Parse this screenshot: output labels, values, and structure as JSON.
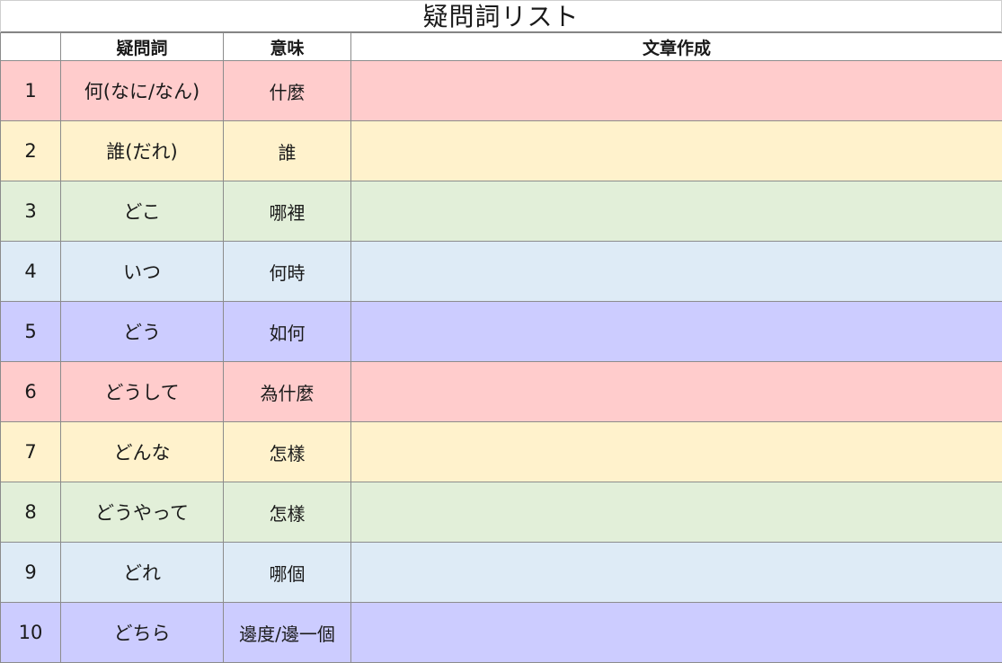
{
  "title": "疑問詞リスト",
  "headers": {
    "number": "",
    "word": "疑問詞",
    "meaning": "意味",
    "sentence": "文章作成"
  },
  "row_colors": {
    "red": "#ffcccc",
    "yellow": "#fff2cc",
    "green": "#e2efd9",
    "blue": "#deebf6",
    "purple": "#ccccff"
  },
  "rows": [
    {
      "num": "1",
      "word": "何(なに/なん)",
      "meaning": "什麼",
      "sentence": "",
      "color": "red"
    },
    {
      "num": "2",
      "word": "誰(だれ)",
      "meaning": "誰",
      "sentence": "",
      "color": "yellow"
    },
    {
      "num": "3",
      "word": "どこ",
      "meaning": "哪裡",
      "sentence": "",
      "color": "green"
    },
    {
      "num": "4",
      "word": "いつ",
      "meaning": "何時",
      "sentence": "",
      "color": "blue"
    },
    {
      "num": "5",
      "word": "どう",
      "meaning": "如何",
      "sentence": "",
      "color": "purple"
    },
    {
      "num": "6",
      "word": "どうして",
      "meaning": "為什麼",
      "sentence": "",
      "color": "red"
    },
    {
      "num": "7",
      "word": "どんな",
      "meaning": "怎樣",
      "sentence": "",
      "color": "yellow"
    },
    {
      "num": "8",
      "word": "どうやって",
      "meaning": "怎樣",
      "sentence": "",
      "color": "green"
    },
    {
      "num": "9",
      "word": "どれ",
      "meaning": "哪個",
      "sentence": "",
      "color": "blue"
    },
    {
      "num": "10",
      "word": "どちら",
      "meaning": "邊度/邊一個",
      "sentence": "",
      "color": "purple"
    }
  ]
}
